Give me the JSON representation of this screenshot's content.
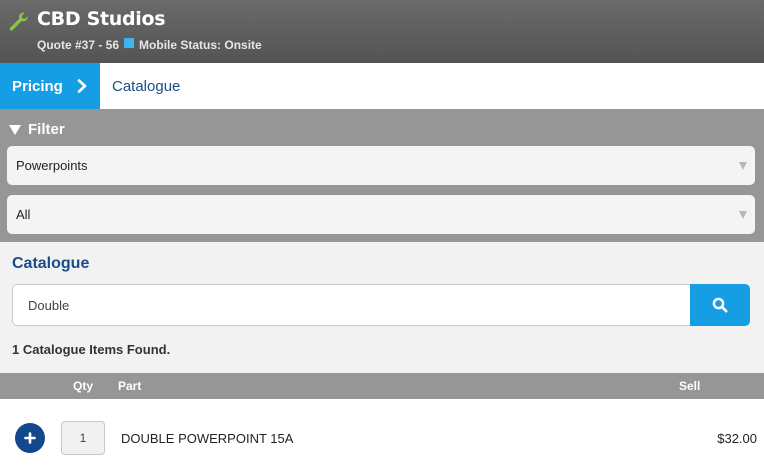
{
  "header": {
    "app_icon": "wrench-icon",
    "title": "CBD Studios",
    "quote_ref": "Quote #37 - 56",
    "status_color": "#3db6ee",
    "status_text": "Mobile Status: Onsite"
  },
  "breadcrumb": {
    "active_label": "Pricing",
    "active_icon": "chevron-right-icon",
    "next_label": "Catalogue"
  },
  "filter": {
    "title": "Filter",
    "icon": "triangle-down-icon",
    "category_select": "Powerpoints",
    "subcategory_select": "All"
  },
  "catalogue": {
    "title": "Catalogue",
    "search_value": "Double",
    "search_icon": "search-icon",
    "found_text": "1 Catalogue Items Found."
  },
  "table": {
    "columns": {
      "qty": "Qty",
      "part": "Part",
      "sell": "Sell"
    },
    "rows": [
      {
        "add_icon": "plus-icon",
        "qty": "1",
        "part": "DOUBLE POWERPOINT 15A",
        "sell": "$32.00"
      }
    ]
  },
  "colors": {
    "header_bg": "#5d5d5d",
    "accent_blue": "#169ee4",
    "title_blue": "#1a4d86",
    "filter_bg": "#969696",
    "add_button": "#12498c",
    "wrench": "#8bc53f"
  }
}
